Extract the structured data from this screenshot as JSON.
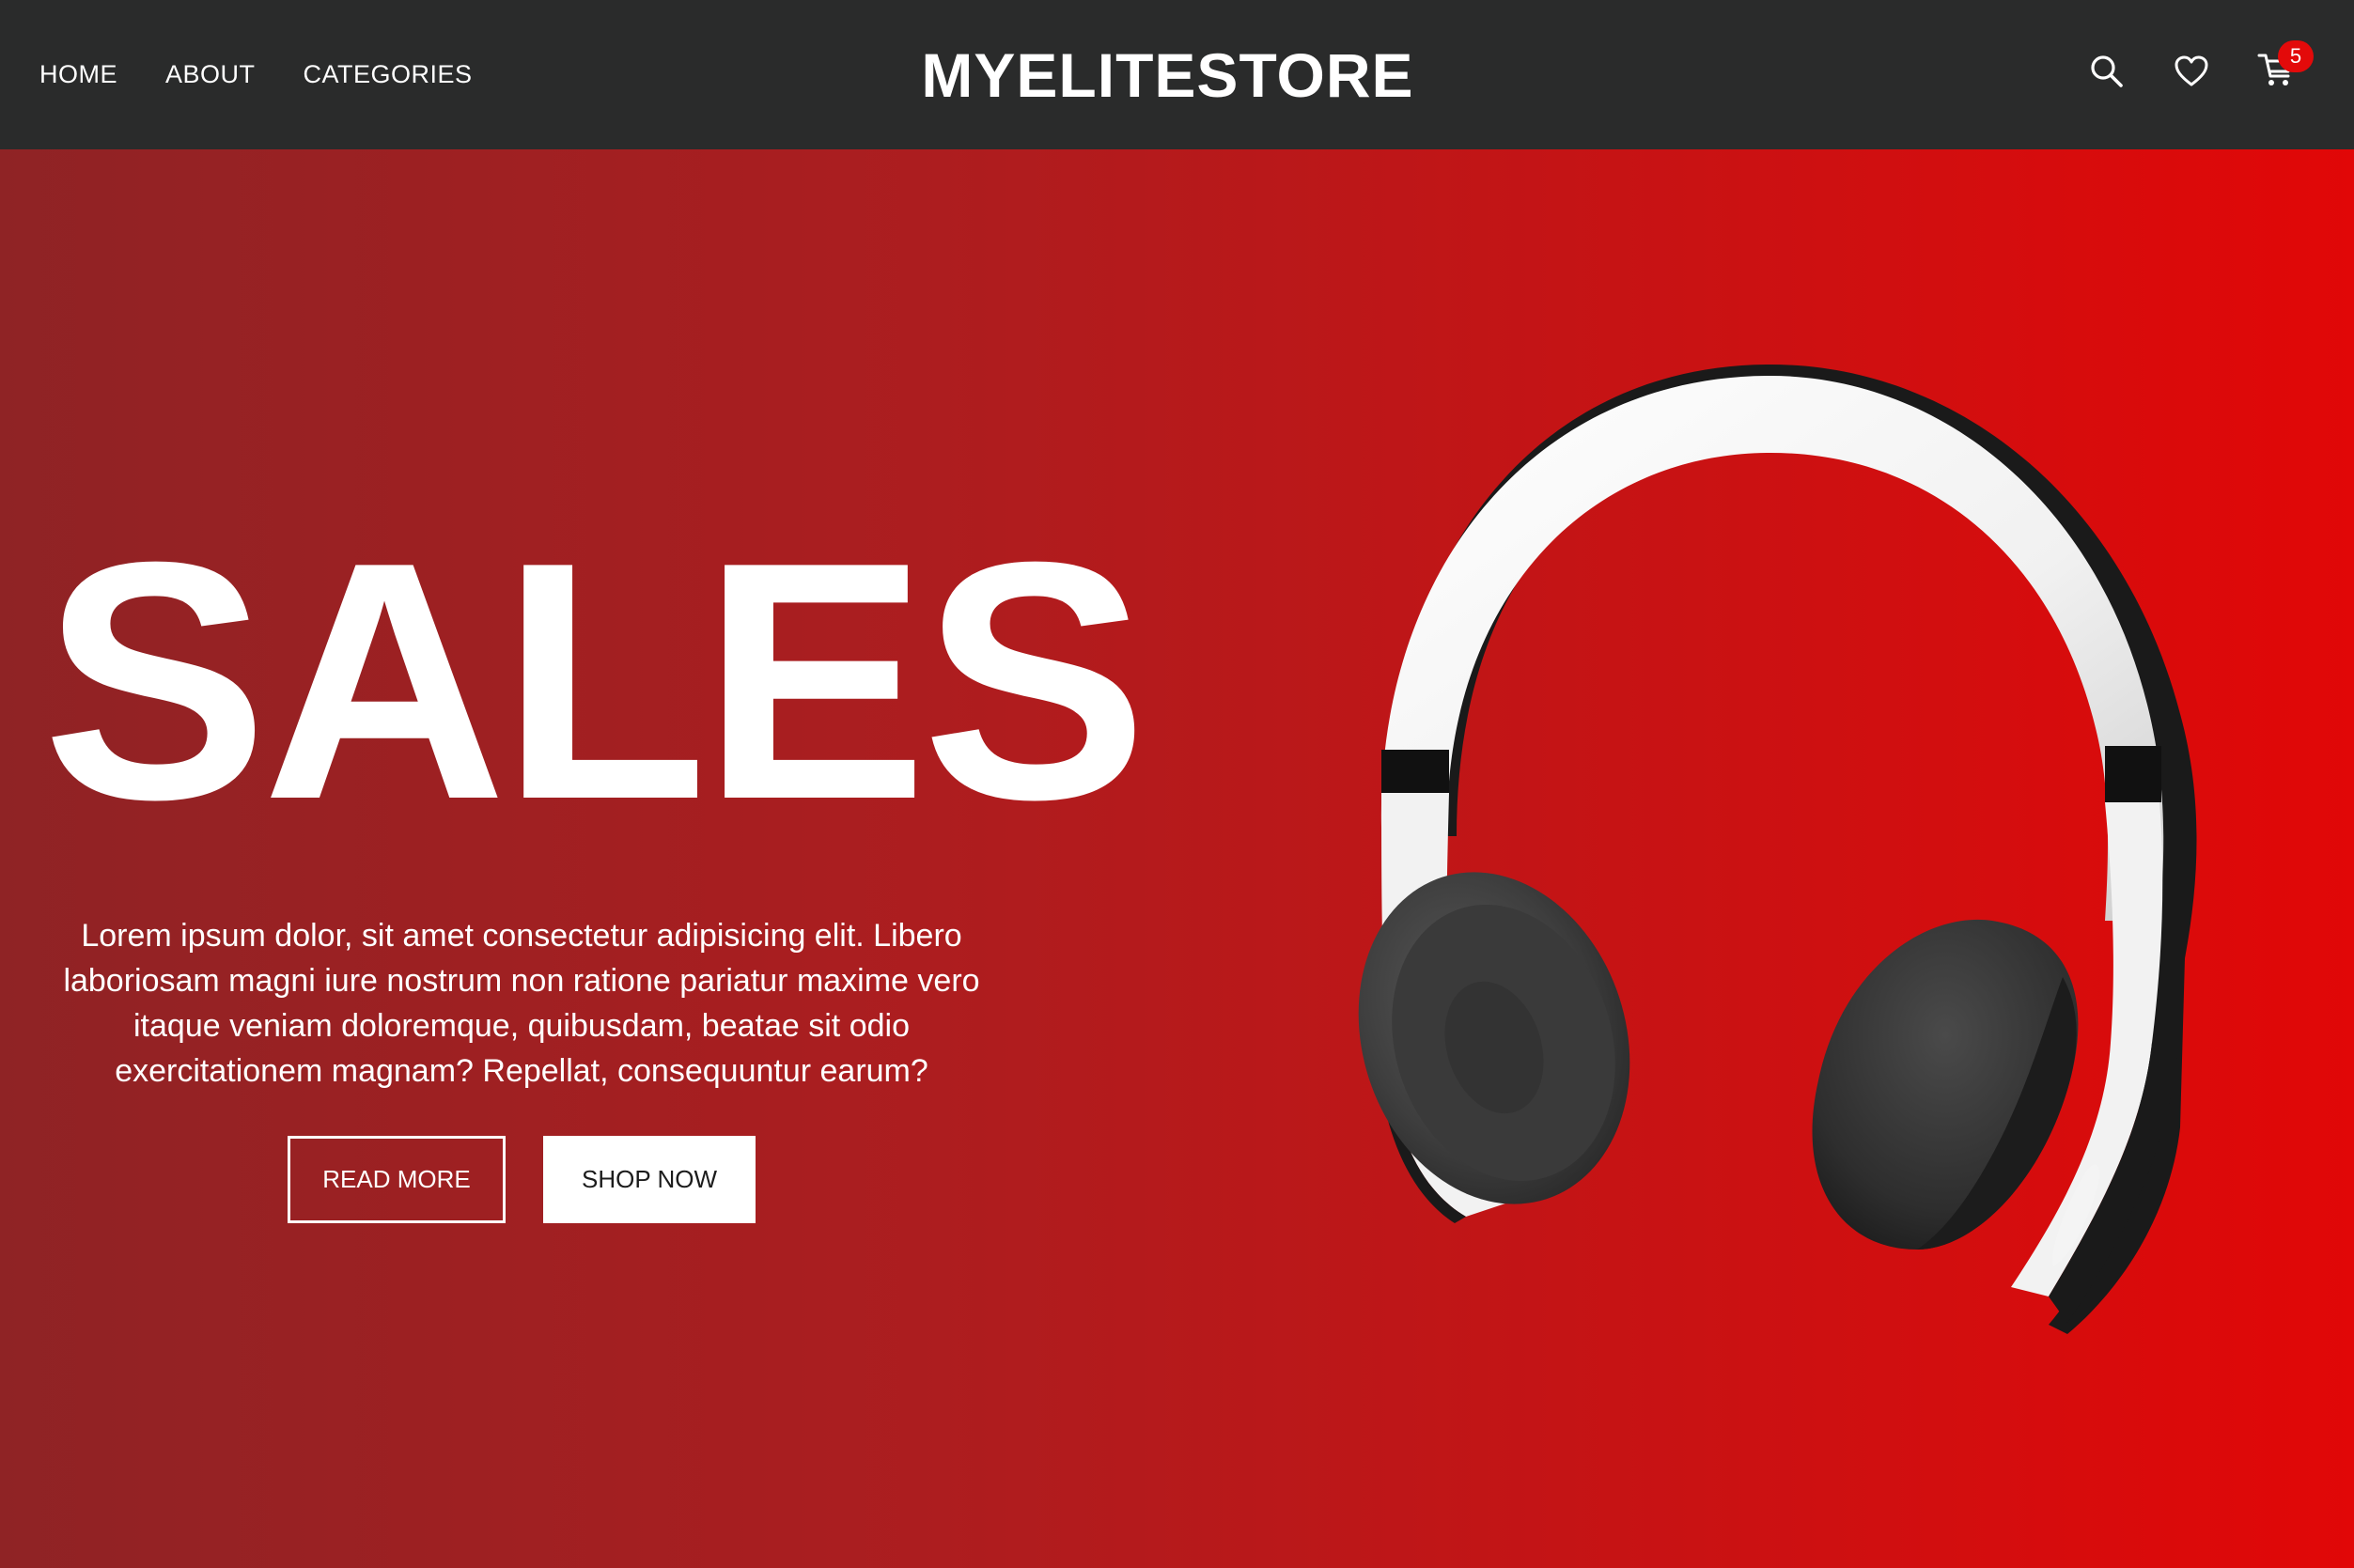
{
  "header": {
    "nav": [
      {
        "label": "HOME"
      },
      {
        "label": "ABOUT"
      },
      {
        "label": "CATEGORIES"
      }
    ],
    "brand": "MYELITESTORE",
    "icons": {
      "search": "search-icon",
      "wishlist": "heart-icon",
      "cart": "cart-icon"
    },
    "cart_count": "5"
  },
  "hero": {
    "title": "SALES",
    "description": "Lorem ipsum dolor, sit amet consectetur adipisicing elit. Libero laboriosam magni iure nostrum non ratione pariatur maxime vero itaque veniam doloremque, quibusdam, beatae sit odio exercitationem magnam? Repellat, consequuntur earum?",
    "buttons": {
      "read_more": "READ MORE",
      "shop_now": "SHOP NOW"
    },
    "image": "headphones-image"
  },
  "colors": {
    "header_bg": "#2a2b2b",
    "hero_gradient_start": "#8f2325",
    "hero_gradient_end": "#e10707",
    "badge": "#e30a0a",
    "text": "#ffffff"
  }
}
